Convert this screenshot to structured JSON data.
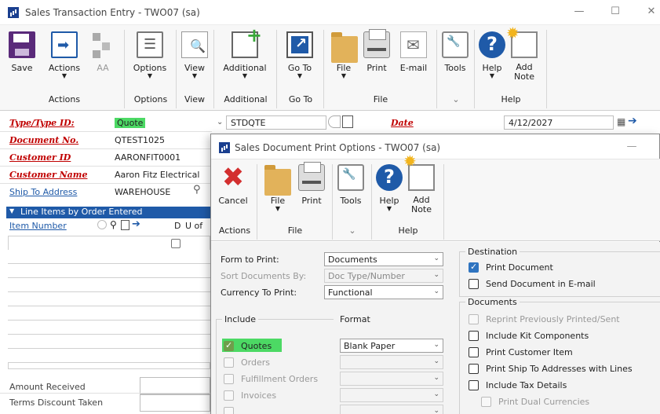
{
  "window": {
    "title": "Sales Transaction Entry  -  TWO07 (sa)",
    "min": "—",
    "max": "☐",
    "close": "✕"
  },
  "ribbon": {
    "buttons": [
      {
        "label": "Save",
        "icon": "save-icon"
      },
      {
        "label": "Actions",
        "icon": "actions-icon",
        "dropdown": true
      },
      {
        "label": "AA",
        "icon": "aa-icon"
      },
      {
        "label": "Options",
        "icon": "options-icon",
        "dropdown": true
      },
      {
        "label": "View",
        "icon": "view-icon",
        "dropdown": true
      },
      {
        "label": "Additional",
        "icon": "additional-icon",
        "dropdown": true
      },
      {
        "label": "Go To",
        "icon": "goto-icon",
        "dropdown": true
      },
      {
        "label": "File",
        "icon": "folder-icon",
        "dropdown": true
      },
      {
        "label": "Print",
        "icon": "printer-icon"
      },
      {
        "label": "E-mail",
        "icon": "email-icon"
      },
      {
        "label": "Tools",
        "icon": "tools-icon"
      },
      {
        "label": "Help",
        "icon": "help-icon",
        "dropdown": true
      },
      {
        "label": "Add Note",
        "icon": "note-icon"
      }
    ],
    "groups": [
      "Actions",
      "Options",
      "View",
      "Additional",
      "Go To",
      "File",
      "⌄",
      "Help"
    ]
  },
  "form": {
    "type_label": "Type/Type ID:",
    "type_value": "Quote",
    "type_id": "STDQTE",
    "date_label": "Date",
    "date_value": "4/12/2027",
    "docno_label": "Document No.",
    "docno_value": "QTEST1025",
    "custid_label": "Customer ID",
    "custid_value": "AARONFIT0001",
    "custname_label": "Customer Name",
    "custname_value": "Aaron Fitz Electrical",
    "shipto_label": "Ship To Address",
    "shipto_value": "WAREHOUSE"
  },
  "grid": {
    "header": "Line Items by Order Entered",
    "col_item": "Item Number",
    "col_d": "D",
    "col_u": "U of"
  },
  "totals": {
    "amount_received": "Amount Received",
    "terms_discount": "Terms Discount Taken"
  },
  "dialog": {
    "title": "Sales Document Print Options  -  TWO07 (sa)",
    "min": "—",
    "ribbon": {
      "cancel": "Cancel",
      "file": "File",
      "print": "Print",
      "tools": "Tools",
      "help": "Help",
      "add_note_1": "Add",
      "add_note_2": "Note",
      "group_actions": "Actions",
      "group_file": "File",
      "group_tools": "⌄",
      "group_help": "Help"
    },
    "form_to_print_label": "Form to Print:",
    "form_to_print_value": "Documents",
    "sort_label": "Sort Documents By:",
    "sort_value": "Doc Type/Number",
    "currency_label": "Currency To Print:",
    "currency_value": "Functional",
    "include_label": "Include",
    "format_label": "Format",
    "include_items": [
      {
        "label": "Quotes",
        "checked": true,
        "enabled": true
      },
      {
        "label": "Orders",
        "checked": false,
        "enabled": false
      },
      {
        "label": "Fulfillment Orders",
        "checked": false,
        "enabled": false
      },
      {
        "label": "Invoices",
        "checked": false,
        "enabled": false
      }
    ],
    "format_value": "Blank Paper",
    "destination_label": "Destination",
    "destination_items": [
      {
        "label": "Print Document",
        "checked": true
      },
      {
        "label": "Send Document in E-mail",
        "checked": false
      }
    ],
    "documents_label": "Documents",
    "documents_items": [
      {
        "label": "Reprint Previously Printed/Sent",
        "checked": false,
        "enabled": false
      },
      {
        "label": "Include Kit Components",
        "checked": false,
        "enabled": true
      },
      {
        "label": "Print Customer Item",
        "checked": false,
        "enabled": true
      },
      {
        "label": "Print Ship To Addresses with Lines",
        "checked": false,
        "enabled": true
      },
      {
        "label": "Include Tax Details",
        "checked": false,
        "enabled": true
      },
      {
        "label": "Print Dual Currencies",
        "checked": false,
        "enabled": false
      }
    ]
  }
}
